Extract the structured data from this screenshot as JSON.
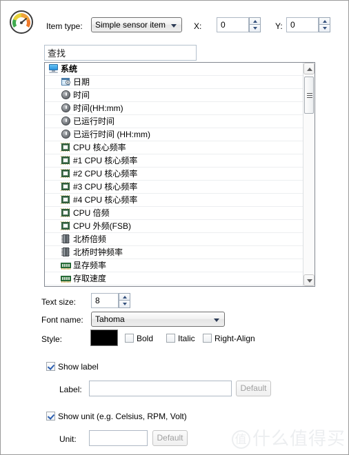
{
  "header": {
    "app_icon": "gauge-icon",
    "item_type_label": "Item type:",
    "item_type_value": "Simple sensor item",
    "x_label": "X:",
    "x_value": "0",
    "y_label": "Y:",
    "y_value": "0"
  },
  "search": {
    "value": "查找",
    "placeholder": "查找"
  },
  "list": {
    "items": [
      {
        "label": "系统",
        "icon": "monitor-icon",
        "level": 0
      },
      {
        "label": "日期",
        "icon": "date-icon",
        "level": 1
      },
      {
        "label": "时间",
        "icon": "clock-icon",
        "level": 1
      },
      {
        "label": "时间(HH:mm)",
        "icon": "clock-icon",
        "level": 1
      },
      {
        "label": "已运行时间",
        "icon": "clock-icon",
        "level": 1
      },
      {
        "label": "已运行时间 (HH:mm)",
        "icon": "clock-icon",
        "level": 1
      },
      {
        "label": "CPU 核心频率",
        "icon": "cpu-icon",
        "level": 1
      },
      {
        "label": "#1 CPU 核心频率",
        "icon": "cpu-icon",
        "level": 1
      },
      {
        "label": "#2 CPU 核心频率",
        "icon": "cpu-icon",
        "level": 1
      },
      {
        "label": "#3 CPU 核心频率",
        "icon": "cpu-icon",
        "level": 1
      },
      {
        "label": "#4 CPU 核心频率",
        "icon": "cpu-icon",
        "level": 1
      },
      {
        "label": "CPU 倍频",
        "icon": "cpu-icon",
        "level": 1
      },
      {
        "label": "CPU 外频(FSB)",
        "icon": "cpu-icon",
        "level": 1
      },
      {
        "label": "北桥倍频",
        "icon": "northbridge-icon",
        "level": 1
      },
      {
        "label": "北桥时钟频率",
        "icon": "northbridge-icon",
        "level": 1
      },
      {
        "label": "显存频率",
        "icon": "memory-icon",
        "level": 1
      },
      {
        "label": "存取速度",
        "icon": "memory-icon",
        "level": 1
      }
    ]
  },
  "text_settings": {
    "text_size_label": "Text size:",
    "text_size_value": "8",
    "font_name_label": "Font name:",
    "font_name_value": "Tahoma",
    "style_label": "Style:",
    "color_value": "#000000",
    "bold_label": "Bold",
    "bold_checked": false,
    "italic_label": "Italic",
    "italic_checked": false,
    "right_align_label": "Right-Align",
    "right_align_checked": false
  },
  "label_section": {
    "show_label": "Show label",
    "show_label_checked": true,
    "label_label": "Label:",
    "label_value": "",
    "default_button": "Default"
  },
  "unit_section": {
    "show_unit": "Show unit (e.g. Celsius, RPM, Volt)",
    "show_unit_checked": true,
    "unit_label": "Unit:",
    "unit_value": "",
    "default_button": "Default"
  },
  "watermark": {
    "mark": "值",
    "text": "什么值得买"
  }
}
